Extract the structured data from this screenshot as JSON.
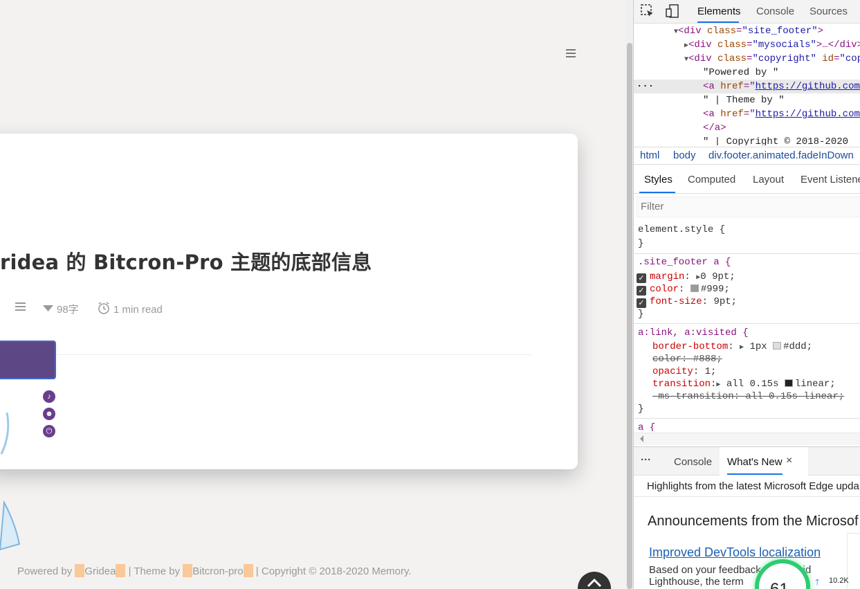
{
  "page": {
    "post_title": "ridea 的 Bitcron-Pro 主题的底部信息",
    "meta": {
      "word_count": "98字",
      "read_time": "1 min read"
    },
    "footer": {
      "powered_by": "Powered by",
      "gridea": "Gridea",
      "theme_by": "| Theme by",
      "bitcron": "Bitcron-pro",
      "copyright": "| Copyright © 2018-2020 Memory."
    },
    "colors": {
      "card_bg": "#ffffff",
      "page_bg": "#f3f2f1",
      "accent_purple": "#5e4785",
      "highlight": "#fbc898"
    }
  },
  "devtools": {
    "tabs": [
      "Elements",
      "Console",
      "Sources"
    ],
    "active_tab": "Elements",
    "dom": {
      "line1_tag": "<div",
      "line1_attr": "class",
      "line1_val": "\"site_footer\"",
      "line2_val": "\"mysocials\"",
      "line2_tail": ">…</div>",
      "line3_val": "\"copyright\"",
      "line3_attr2": "id",
      "line3_val2": "\"cop",
      "text_powered": "\"Powered by \"",
      "a_tag": "<a",
      "a_attr": "href",
      "a_link": "https://github.com/",
      "text_theme": "\"  |  Theme by \"",
      "a_close": "</a>",
      "text_copyright": "\"  |  Copyright © 2018-2020",
      "dots": "···"
    },
    "breadcrumbs": [
      "html",
      "body",
      "div.footer.animated.fadeInDown"
    ],
    "subtabs": [
      "Styles",
      "Computed",
      "Layout",
      "Event Listene"
    ],
    "filter_placeholder": "Filter",
    "styles": {
      "element_style": "element.style {",
      "close": "}",
      "rule1_selector": ".site_footer a {",
      "margin_prop": "margin",
      "margin_val": "0 9pt;",
      "color_prop": "color",
      "color_val": "#999;",
      "fontsize_prop": "font-size",
      "fontsize_val": "9pt;",
      "rule2_selector": "a:link, a:visited {",
      "border_prop": "border-bottom",
      "border_val_a": "1px",
      "border_val_b": "#ddd;",
      "color2": "color: #888;",
      "opacity_prop": "opacity",
      "opacity_val": "1;",
      "transition_prop": "transition",
      "transition_val_a": "all 0.15s",
      "transition_val_b": "linear;",
      "ms_transition": "-ms-transition: all 0.15s linear;",
      "rule3_selector": "a {"
    },
    "drawer": {
      "more": "···",
      "tabs": [
        "Console",
        "What's New"
      ],
      "close": "×"
    },
    "whats_new": {
      "header": "Highlights from the latest Microsoft Edge upda",
      "title": "Announcements from the Microsof",
      "link": "Improved DevTools localization",
      "body_line1": "Based on your feedback,     ow provid",
      "body_line2": "Lighthouse, the term"
    },
    "perf": {
      "score": "61",
      "memory": "10.2K"
    }
  }
}
